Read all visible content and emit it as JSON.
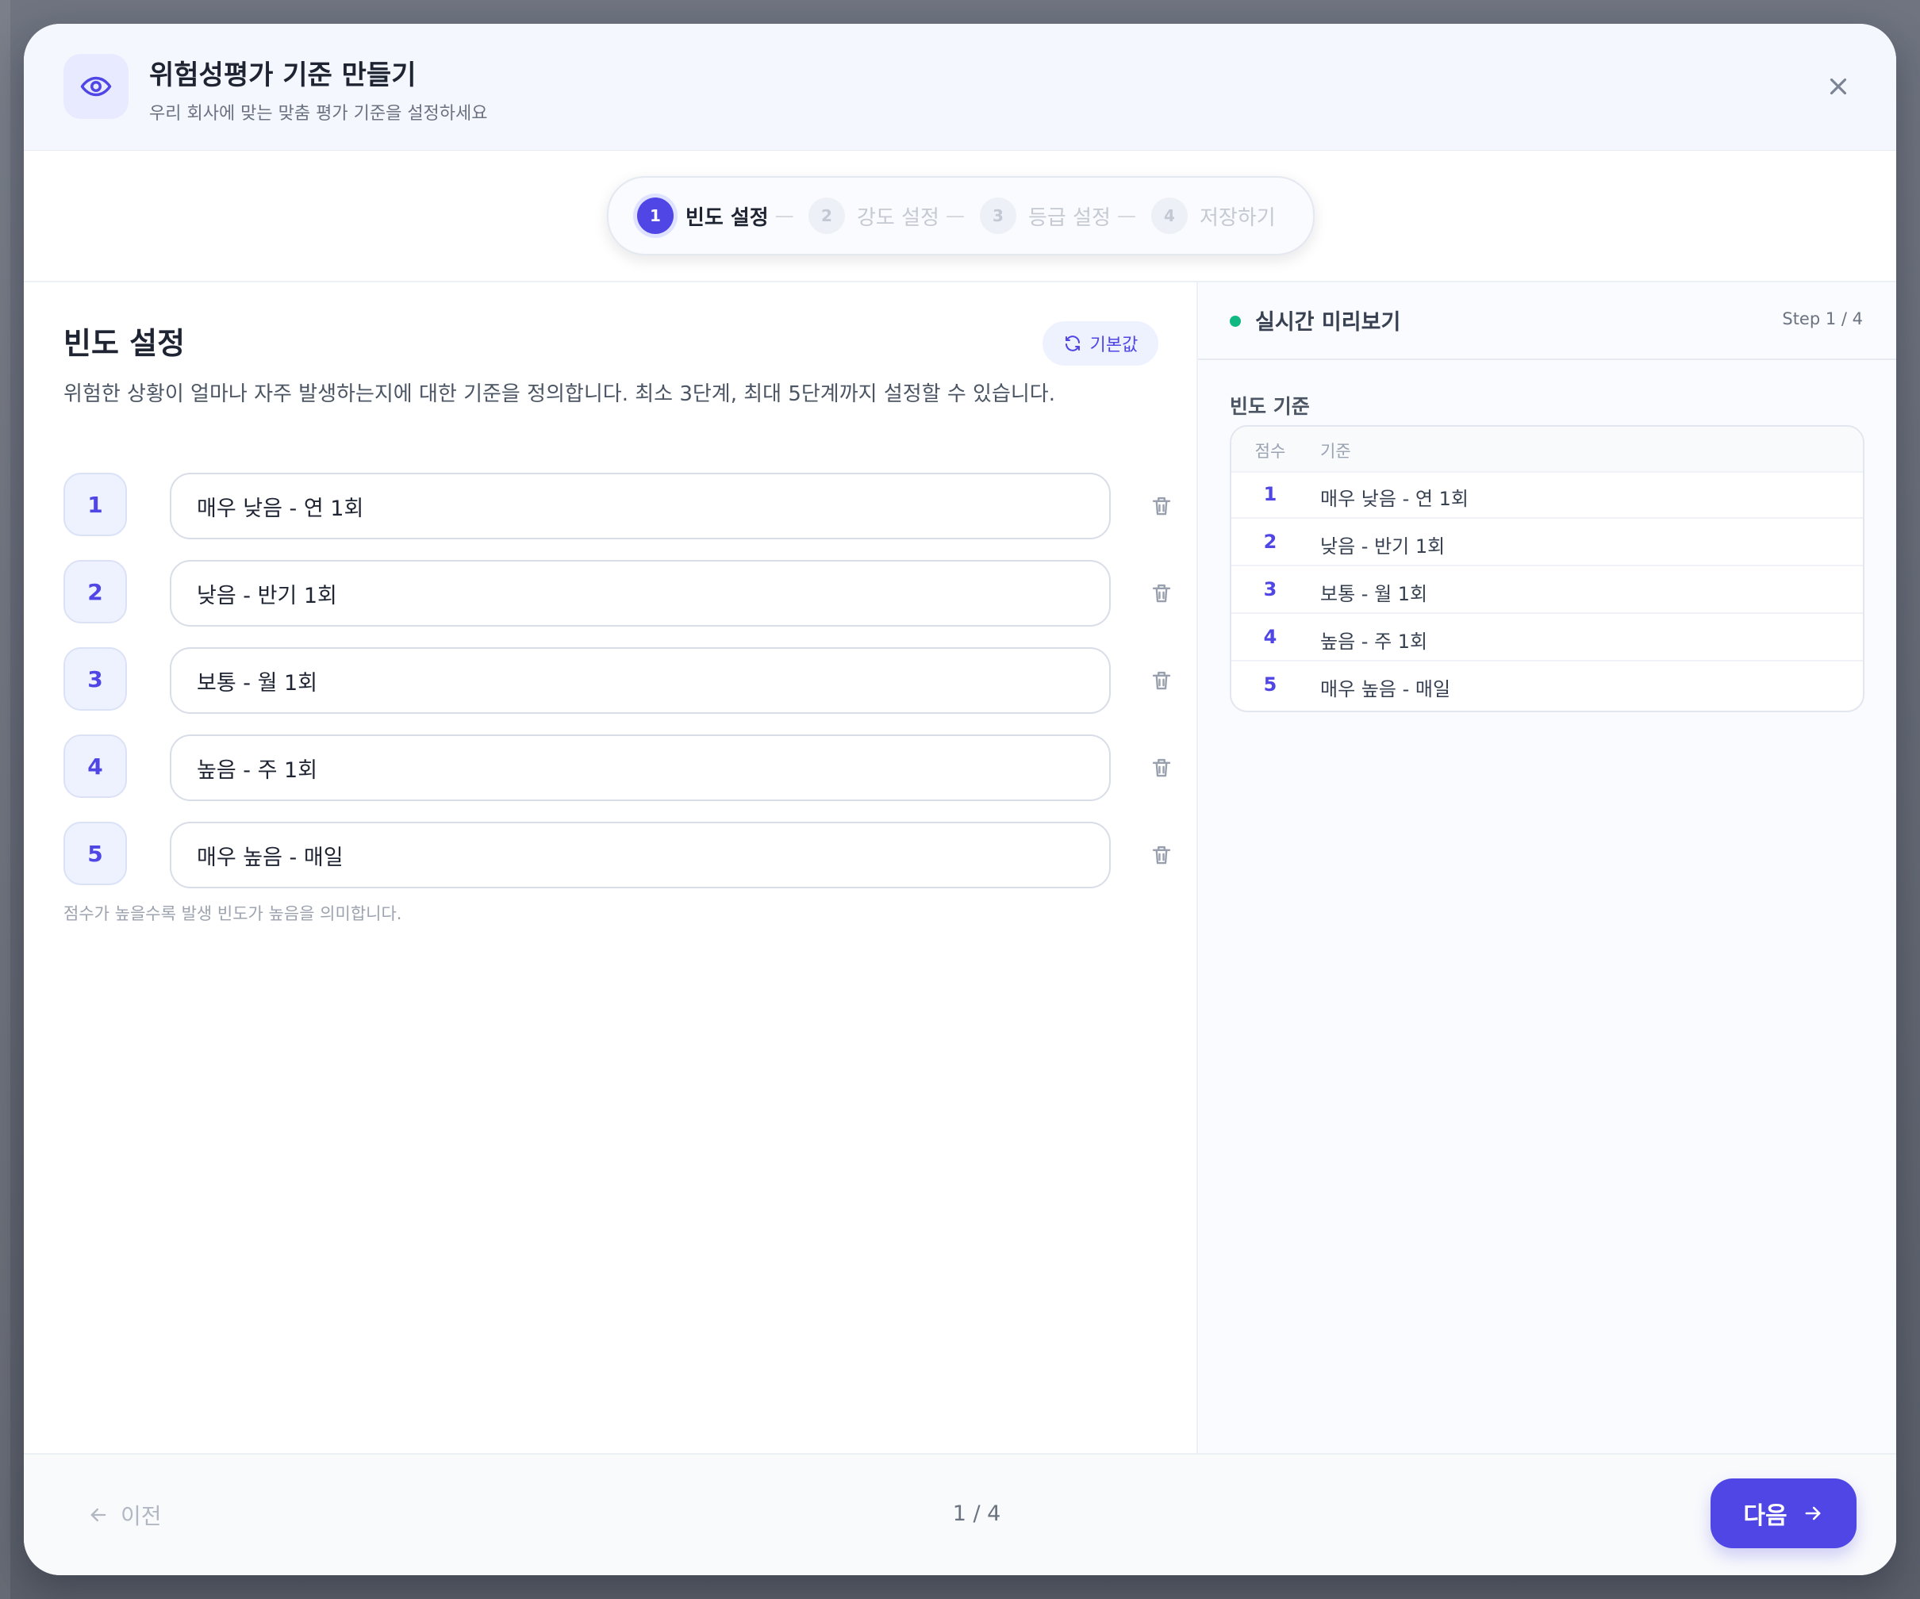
{
  "modal": {
    "title": "위험성평가 기준 만들기",
    "subtitle": "우리 회사에 맞는 맞춤 평가 기준을 설정하세요"
  },
  "steps": [
    {
      "number": "1",
      "label": "빈도 설정",
      "state": "active"
    },
    {
      "number": "2",
      "label": "강도 설정",
      "state": "inactive"
    },
    {
      "number": "3",
      "label": "등급 설정",
      "state": "inactive"
    },
    {
      "number": "4",
      "label": "저장하기",
      "state": "inactive"
    }
  ],
  "step_separator": "—",
  "frequency_section": {
    "title": "빈도 설정",
    "description": "위험한 상황이 얼마나 자주 발생하는지에 대한 기준을 정의합니다. 최소 3단계, 최대 5단계까지 설정할 수 있습니다.",
    "reset_label": "기본값",
    "helper_text": "점수가 높을수록 발생 빈도가 높음을 의미합니다.",
    "items": [
      {
        "score": "1",
        "value": "매우 낮음 - 연 1회"
      },
      {
        "score": "2",
        "value": "낮음 - 반기 1회"
      },
      {
        "score": "3",
        "value": "보통 - 월 1회"
      },
      {
        "score": "4",
        "value": "높음 - 주 1회"
      },
      {
        "score": "5",
        "value": "매우 높음 - 매일"
      }
    ]
  },
  "preview": {
    "title": "실시간 미리보기",
    "step_text": "Step 1 / 4",
    "subtitle": "빈도 기준",
    "table_headers": {
      "score": "점수",
      "criteria": "기준"
    },
    "rows": [
      {
        "score": "1",
        "criteria": "매우 낮음 - 연 1회"
      },
      {
        "score": "2",
        "criteria": "낮음 - 반기 1회"
      },
      {
        "score": "3",
        "criteria": "보통 - 월 1회"
      },
      {
        "score": "4",
        "criteria": "높음 - 주 1회"
      },
      {
        "score": "5",
        "criteria": "매우 높음 - 매일"
      }
    ]
  },
  "footer": {
    "prev_label": "이전",
    "page_indicator": "1 / 4",
    "next_label": "다음"
  },
  "colors": {
    "accent": "#4f46e5",
    "success": "#10b981",
    "muted_text": "#9ca3af"
  },
  "icons": {
    "header": "eye-icon",
    "close": "close-icon",
    "reset": "refresh-icon",
    "delete": "trash-icon",
    "previous": "arrow-left-icon",
    "next": "arrow-right-icon"
  }
}
